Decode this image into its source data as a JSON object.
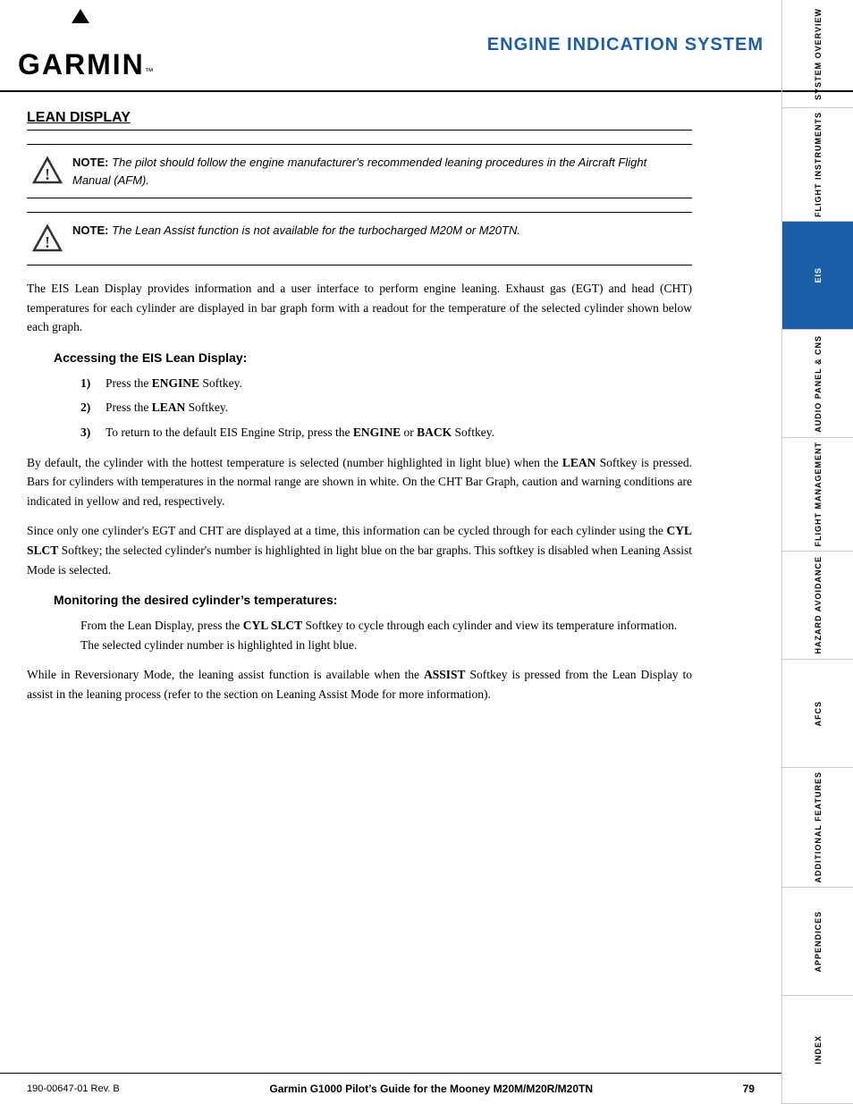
{
  "header": {
    "logo": "GARMIN",
    "title": "ENGINE INDICATION SYSTEM"
  },
  "sidebar": {
    "items": [
      {
        "label": "SYSTEM OVERVIEW",
        "active": false
      },
      {
        "label": "FLIGHT INSTRUMENTS",
        "active": false
      },
      {
        "label": "EIS",
        "active": true
      },
      {
        "label": "AUDIO PANEL & CNS",
        "active": false
      },
      {
        "label": "FLIGHT MANAGEMENT",
        "active": false
      },
      {
        "label": "HAZARD AVOIDANCE",
        "active": false
      },
      {
        "label": "AFCS",
        "active": false
      },
      {
        "label": "ADDITIONAL FEATURES",
        "active": false
      },
      {
        "label": "APPENDICES",
        "active": false
      },
      {
        "label": "INDEX",
        "active": false
      }
    ]
  },
  "section": {
    "title": "LEAN DISPLAY",
    "note1": {
      "label": "NOTE:",
      "text": " The pilot should follow the engine manufacturer's recommended leaning procedures in the Aircraft Flight Manual (AFM)."
    },
    "note2": {
      "label": "NOTE:",
      "text": " The Lean Assist function is not available for the turbocharged M20M or M20TN."
    },
    "para1": "The EIS Lean Display provides information and a user interface to perform engine leaning.  Exhaust gas (EGT) and head (CHT) temperatures for each cylinder are displayed in bar graph form with a readout for the temperature of the selected cylinder shown below each graph.",
    "sub1": "Accessing the EIS Lean Display:",
    "steps": [
      {
        "num": "1)",
        "text": "Press the ",
        "bold": "ENGINE",
        "rest": " Softkey."
      },
      {
        "num": "2)",
        "text": "Press the ",
        "bold": "LEAN",
        "rest": " Softkey."
      },
      {
        "num": "3)",
        "text": "To return to the default EIS Engine Strip, press the ",
        "bold1": "ENGINE",
        "mid": " or ",
        "bold2": "BACK",
        "end": " Softkey."
      }
    ],
    "para2_1": "By default, the cylinder with the hottest temperature is selected (number highlighted in light blue) when the ",
    "para2_bold": "LEAN",
    "para2_2": " Softkey is pressed.  Bars for cylinders with temperatures in the normal range are shown in white.  On the CHT Bar Graph, caution and warning conditions are indicated in yellow and red, respectively.",
    "para3": "Since only one cylinder’s EGT and CHT are displayed at a time, this information can be cycled through for each cylinder using the ",
    "para3_bold": "CYL SLCT",
    "para3_2": " Softkey; the selected cylinder’s number is highlighted in light blue on the bar graphs.  This softkey is disabled when Leaning Assist Mode is selected.",
    "sub2": "Monitoring the desired cylinder’s temperatures:",
    "indented": "From the Lean Display, press the ",
    "indented_bold": "CYL SLCT",
    "indented_2": " Softkey to cycle through each cylinder and view its temperature information.  The selected cylinder number is highlighted in light blue.",
    "para4_1": "While in Reversionary Mode, the leaning assist function is available when the ",
    "para4_bold": "ASSIST",
    "para4_2": " Softkey is pressed from the Lean Display to assist in the leaning process (refer to the section on Leaning Assist Mode for more information)."
  },
  "footer": {
    "left": "190-00647-01  Rev. B",
    "center": "Garmin G1000 Pilot’s Guide for the Mooney M20M/M20R/M20TN",
    "page": "79"
  }
}
